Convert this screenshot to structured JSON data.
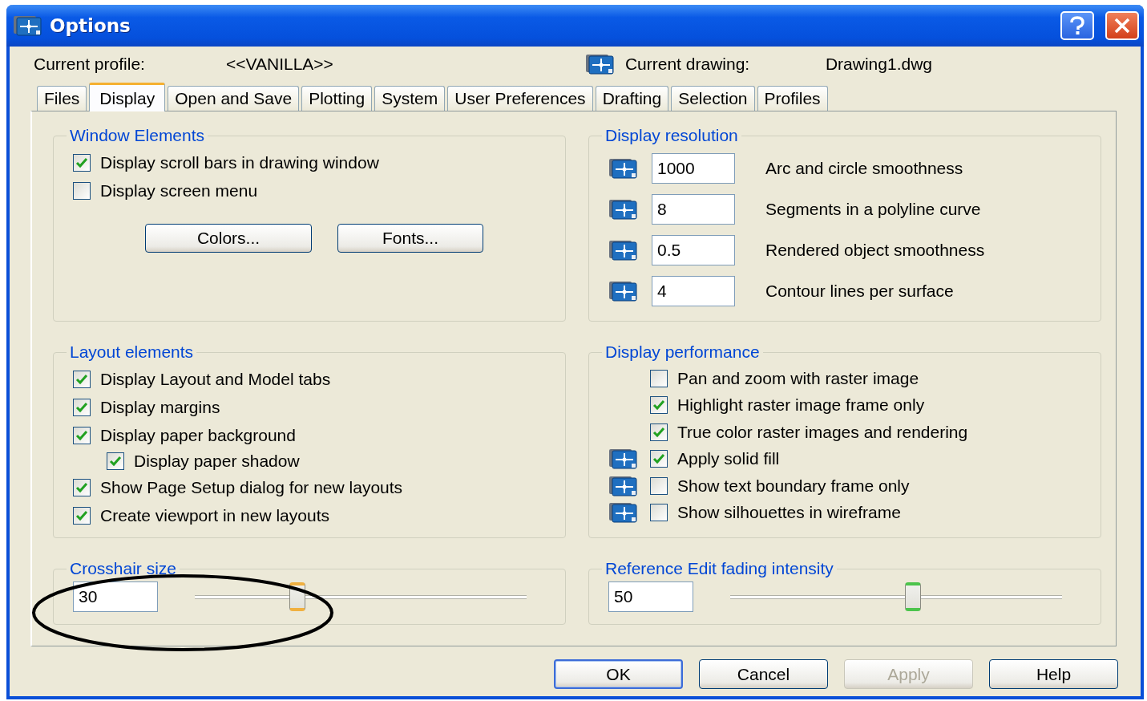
{
  "window": {
    "title": "Options"
  },
  "profile": {
    "label": "Current profile:",
    "value": "<<VANILLA>>"
  },
  "drawing": {
    "label": "Current drawing:",
    "value": "Drawing1.dwg"
  },
  "tabs": [
    {
      "label": "Files",
      "selected": false
    },
    {
      "label": "Display",
      "selected": true
    },
    {
      "label": "Open and Save",
      "selected": false
    },
    {
      "label": "Plotting",
      "selected": false
    },
    {
      "label": "System",
      "selected": false
    },
    {
      "label": "User Preferences",
      "selected": false
    },
    {
      "label": "Drafting",
      "selected": false
    },
    {
      "label": "Selection",
      "selected": false
    },
    {
      "label": "Profiles",
      "selected": false
    }
  ],
  "window_elements": {
    "title": "Window Elements",
    "checkboxes": [
      {
        "label": "Display scroll bars in drawing window",
        "checked": true
      },
      {
        "label": "Display screen menu",
        "checked": false
      }
    ],
    "buttons": [
      "Colors...",
      "Fonts..."
    ]
  },
  "display_resolution": {
    "title": "Display resolution",
    "rows": [
      {
        "value": "1000",
        "label": "Arc and circle smoothness"
      },
      {
        "value": "8",
        "label": "Segments in a polyline curve"
      },
      {
        "value": "0.5",
        "label": "Rendered object smoothness"
      },
      {
        "value": "4",
        "label": "Contour lines per surface"
      }
    ]
  },
  "layout_elements": {
    "title": "Layout elements",
    "checkboxes": [
      {
        "label": "Display Layout and Model tabs",
        "checked": true
      },
      {
        "label": "Display margins",
        "checked": true
      },
      {
        "label": "Display paper background",
        "checked": true,
        "children": [
          {
            "label": "Display paper shadow",
            "checked": true
          }
        ]
      },
      {
        "label": "Show Page Setup dialog for new layouts",
        "checked": true
      },
      {
        "label": "Create viewport in new layouts",
        "checked": true
      }
    ]
  },
  "display_performance": {
    "title": "Display performance",
    "checkboxes": [
      {
        "label": "Pan and zoom with raster image",
        "checked": false,
        "kind": "plain"
      },
      {
        "label": "Highlight raster image frame only",
        "checked": true,
        "kind": "plain"
      },
      {
        "label": "True color raster images and rendering",
        "checked": true,
        "kind": "plain"
      },
      {
        "label": "Apply solid fill",
        "checked": true,
        "kind": "saved"
      },
      {
        "label": "Show text boundary frame only",
        "checked": false,
        "kind": "saved"
      },
      {
        "label": "Show silhouettes in wireframe",
        "checked": false,
        "kind": "saved"
      }
    ]
  },
  "crosshair": {
    "title": "Crosshair size",
    "value": "30",
    "level": 0.31
  },
  "fading": {
    "title": "Reference Edit fading intensity",
    "value": "50",
    "level": 0.55
  },
  "annotation": {
    "kind": "ellipse"
  },
  "buttons": [
    {
      "label": "OK",
      "disabled": false,
      "default": true
    },
    {
      "label": "Cancel",
      "disabled": false,
      "default": false
    },
    {
      "label": "Apply",
      "disabled": true,
      "default": false
    },
    {
      "label": "Help",
      "disabled": false,
      "default": false
    }
  ]
}
